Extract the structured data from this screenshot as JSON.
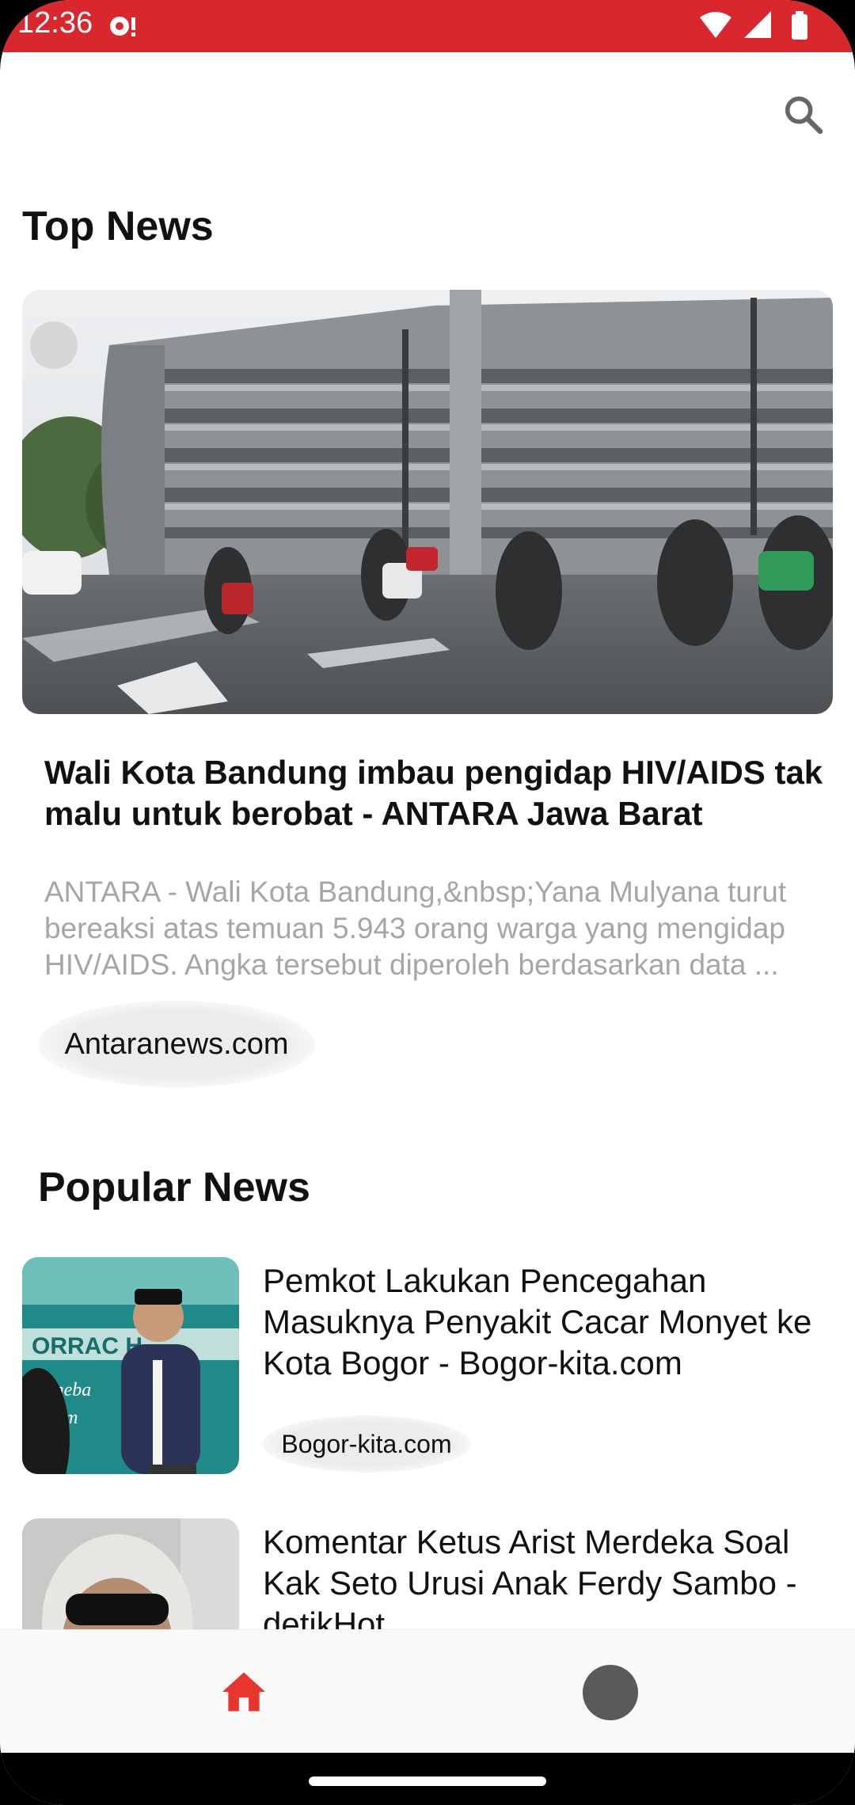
{
  "status_bar": {
    "time": "12:36",
    "background": "#d9272e"
  },
  "header": {
    "search_icon": "search-icon"
  },
  "top_news": {
    "section_title": "Top News",
    "headline": "Wali Kota Bandung imbau pengidap HIV/AIDS tak malu untuk berobat - ANTARA Jawa Barat",
    "description": "ANTARA - Wali Kota Bandung,&nbsp;Yana Mulyana turut bereaksi atas temuan 5.943 orang warga yang mengidap HIV/AIDS. Angka tersebut diperoleh berdasarkan data ...",
    "source": "Antaranews.com"
  },
  "popular_news": {
    "section_title": "Popular News",
    "items": [
      {
        "headline": "Pemkot Lakukan Pencegahan Masuknya Penyakit Cacar Monyet ke Kota Bogor - Bogor-kita.com",
        "source": "Bogor-kita.com"
      },
      {
        "headline": "Komentar Ketus Arist Merdeka Soal Kak Seto Urusi Anak Ferdy Sambo - detikHot",
        "source": ""
      }
    ]
  },
  "bottom_nav": {
    "items": [
      {
        "icon": "home-icon",
        "active": true,
        "color": "#e8352e"
      },
      {
        "icon": "profile-avatar",
        "active": false,
        "color": "#5a5a5a"
      }
    ]
  }
}
